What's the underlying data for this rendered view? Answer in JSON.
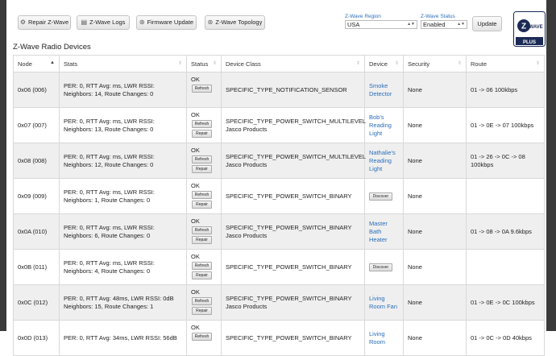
{
  "toolbar": {
    "repair_label": "Repair Z-Wave",
    "logs_label": "Z-Wave Logs",
    "firmware_label": "Firmware Update",
    "topology_label": "Z-Wave Topology"
  },
  "region": {
    "label": "Z-Wave Region",
    "value": "USA"
  },
  "status_select": {
    "label": "Z-Wave Status",
    "value": "Enabled"
  },
  "update_label": "Update",
  "logo": {
    "line1": "Z",
    "line2": "WAVE",
    "line3": "PLUS"
  },
  "section_title": "Z-Wave Radio Devices",
  "columns": {
    "node": "Node",
    "stats": "Stats",
    "status": "Status",
    "device_class": "Device Class",
    "device": "Device",
    "security": "Security",
    "route": "Route"
  },
  "buttons": {
    "refresh": "Refresh",
    "repair": "Repair",
    "discover": "Discover"
  },
  "rows": [
    {
      "node": "0x06 (006)",
      "stats1": "PER: 0, RTT Avg: ms, LWR RSSI:",
      "stats2": "Neighbors: 14, Route Changes: 0",
      "status": "OK",
      "class1": "SPECIFIC_TYPE_NOTIFICATION_SENSOR",
      "class2": "",
      "device1": "Smoke",
      "device2": "Detector",
      "device3": "",
      "security": "None",
      "route1": "01 -> 06 100kbps",
      "route2": ""
    },
    {
      "node": "0x07 (007)",
      "stats1": "PER: 0, RTT Avg: ms, LWR RSSI:",
      "stats2": "Neighbors: 13, Route Changes: 0",
      "status": "OK",
      "class1": "SPECIFIC_TYPE_POWER_SWITCH_MULTILEVEL",
      "class2": "Jasco Products",
      "device1": "Bob's",
      "device2": "Reading",
      "device3": "Light",
      "security": "None",
      "route1": "01 -> 0E -> 07 100kbps",
      "route2": ""
    },
    {
      "node": "0x08 (008)",
      "stats1": "PER: 0, RTT Avg: ms, LWR RSSI:",
      "stats2": "Neighbors: 12, Route Changes: 0",
      "status": "OK",
      "class1": "SPECIFIC_TYPE_POWER_SWITCH_MULTILEVEL",
      "class2": "Jasco Products",
      "device1": "Nathalie's",
      "device2": "Reading",
      "device3": "Light",
      "security": "None",
      "route1": "01 -> 26 -> 0C -> 08",
      "route2": "100kbps"
    },
    {
      "node": "0x09 (009)",
      "stats1": "PER: 0, RTT Avg: ms, LWR RSSI:",
      "stats2": "Neighbors: 1, Route Changes: 0",
      "status": "OK",
      "class1": "SPECIFIC_TYPE_POWER_SWITCH_BINARY",
      "class2": "",
      "device1": "",
      "device2": "",
      "device3": "",
      "security": "None",
      "route1": "",
      "route2": ""
    },
    {
      "node": "0x0A (010)",
      "stats1": "PER: 0, RTT Avg: ms, LWR RSSI:",
      "stats2": "Neighbors: 6, Route Changes: 0",
      "status": "OK",
      "class1": "SPECIFIC_TYPE_POWER_SWITCH_BINARY",
      "class2": "Jasco Products",
      "device1": "Master",
      "device2": "Bath",
      "device3": "Heater",
      "security": "None",
      "route1": "01 -> 08 -> 0A 9.6kbps",
      "route2": ""
    },
    {
      "node": "0x0B (011)",
      "stats1": "PER: 0, RTT Avg: ms, LWR RSSI:",
      "stats2": "Neighbors: 4, Route Changes: 0",
      "status": "OK",
      "class1": "SPECIFIC_TYPE_POWER_SWITCH_BINARY",
      "class2": "",
      "device1": "",
      "device2": "",
      "device3": "",
      "security": "None",
      "route1": "",
      "route2": ""
    },
    {
      "node": "0x0C (012)",
      "stats1": "PER: 0, RTT Avg: 48ms, LWR RSSI: 0dB",
      "stats2": "Neighbors: 15, Route Changes: 1",
      "status": "OK",
      "class1": "SPECIFIC_TYPE_POWER_SWITCH_BINARY",
      "class2": "Jasco Products",
      "device1": "Living",
      "device2": "Room Fan",
      "device3": "",
      "security": "None",
      "route1": "01 -> 0E -> 0C 100kbps",
      "route2": ""
    },
    {
      "node": "0x0D (013)",
      "stats1": "PER: 0, RTT Avg: 34ms, LWR RSSI: 56dB",
      "stats2": "",
      "status": "OK",
      "class1": "SPECIFIC_TYPE_POWER_SWITCH_BINARY",
      "class2": "",
      "device1": "Living",
      "device2": "Room",
      "device3": "",
      "security": "None",
      "route1": "01 -> 0C -> 0D 40kbps",
      "route2": ""
    }
  ]
}
